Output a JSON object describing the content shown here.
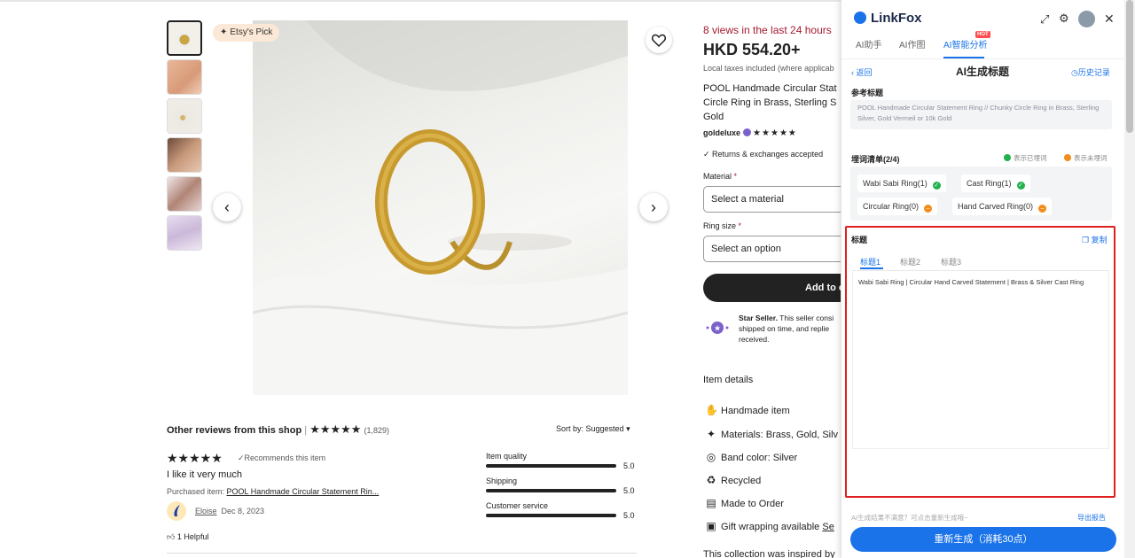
{
  "gallery": {
    "badge": "Etsy's Pick",
    "thumbnails": [
      "thumb-1",
      "thumb-2",
      "thumb-3",
      "thumb-4",
      "thumb-5",
      "thumb-6"
    ]
  },
  "product": {
    "views": "8 views in the last 24 hours",
    "price": "HKD 554.20+",
    "tax_note": "Local taxes included (where applicab",
    "title": "POOL Handmade Circular Stat Circle Ring in Brass, Sterling S Gold",
    "seller": "goldeluxe",
    "seller_stars": "★★★★★",
    "returns": "Returns & exchanges accepted",
    "material_label": "Material",
    "material_placeholder": "Select a material",
    "ringsize_label": "Ring size",
    "ringsize_placeholder": "Select an option",
    "add_to_cart": "Add to c",
    "star_seller_title": "Star Seller.",
    "star_seller_text": "This seller consi shipped on time, and replie received.",
    "item_details": "Item details",
    "details": [
      {
        "icon": "hand-icon",
        "text": "Handmade item"
      },
      {
        "icon": "sparkle-icon",
        "text": "Materials: Brass, Gold, Silv"
      },
      {
        "icon": "ring-icon",
        "text": "Band color: Silver"
      },
      {
        "icon": "recycle-icon",
        "text": "Recycled"
      },
      {
        "icon": "clipboard-icon",
        "text": "Made to Order"
      },
      {
        "icon": "gift-icon",
        "text": "Gift wrapping available"
      }
    ],
    "gift_link": "Se",
    "collection": "This collection was inspired by"
  },
  "reviews": {
    "header": "Other reviews from this shop",
    "header_stars": "★★★★★",
    "count": "(1,829)",
    "sort": "Sort by: Suggested",
    "review_stars": "★★★★★",
    "recommend": "Recommends this item",
    "text": "I like it very much",
    "purchased_label": "Purchased item:",
    "purchased_item": "POOL Handmade Circular Statement Rin...",
    "reviewer": "Eloise",
    "date": "Dec 8, 2023",
    "helpful": "1 Helpful",
    "ratings": [
      {
        "label": "Item quality",
        "value": "5.0"
      },
      {
        "label": "Shipping",
        "value": "5.0"
      },
      {
        "label": "Customer service",
        "value": "5.0"
      }
    ]
  },
  "linkfox": {
    "logo": "LinkFox",
    "tabs": [
      "AI助手",
      "AI作图",
      "AI智能分析"
    ],
    "hot": "HOT",
    "back": "返回",
    "title": "AI生成标题",
    "history": "历史记录",
    "ref_title_label": "参考标题",
    "ref_title": "POOL Handmade Circular Statement Ring // Chunky Circle Ring in Brass, Sterling Silver, Gold Vermeil or 10k Gold",
    "keywords_label": "埋词清单(2/4)",
    "legend_buried": "表示已埋词",
    "legend_unburied": "表示未埋词",
    "keywords": [
      {
        "text": "Wabi Sabi Ring(1)",
        "status": "buried"
      },
      {
        "text": "Cast Ring(1)",
        "status": "buried"
      },
      {
        "text": "Circular Ring(0)",
        "status": "unburied"
      },
      {
        "text": "Hand Carved Ring(0)",
        "status": "unburied"
      }
    ],
    "titles_label": "标题",
    "copy": "复制",
    "subtabs": [
      "标题1",
      "标题2",
      "标题3"
    ],
    "generated": "Wabi Sabi Ring | Circular Hand Carved Statement | Brass & Silver Cast Ring",
    "footnote": "AI生成结果不满意？可点击重新生成哦~",
    "export": "导出报告",
    "regenerate": "重新生成（消耗30点）",
    "colors": {
      "accent": "#1a73e8",
      "buried": "#22b14c",
      "unburied": "#f28c1b",
      "highlight": "#e02020"
    }
  }
}
